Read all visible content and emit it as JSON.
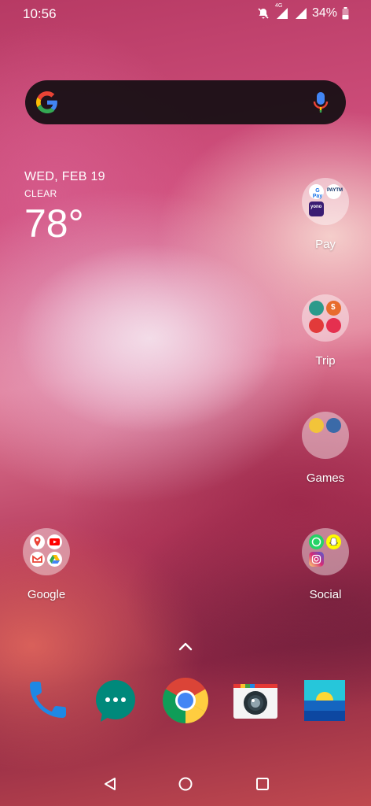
{
  "status_bar": {
    "time": "10:56",
    "network": "4G",
    "battery": "34%",
    "icons": [
      "mute-icon",
      "signal-icon",
      "signal-icon-2",
      "battery-icon"
    ]
  },
  "search_bar": {
    "logo": "google-g-icon",
    "mic": "mic-icon"
  },
  "weather": {
    "date": "WED, FEB 19",
    "condition": "CLEAR",
    "temperature": "78°"
  },
  "folders": [
    {
      "label": "Pay",
      "apps": [
        "google-pay",
        "paytm",
        "yono-sbi"
      ]
    },
    {
      "label": "Trip",
      "apps": [
        "trip-app-1",
        "trip-app-2",
        "trip-app-3",
        "trip-app-4"
      ]
    },
    {
      "label": "Games",
      "apps": [
        "game-1",
        "game-2"
      ]
    },
    {
      "label": "Google",
      "apps": [
        "maps",
        "youtube",
        "gmail",
        "drive"
      ]
    },
    {
      "label": "Social",
      "apps": [
        "whatsapp",
        "snapchat",
        "instagram"
      ]
    }
  ],
  "dock": [
    "phone",
    "messages",
    "chrome",
    "camera",
    "gallery"
  ],
  "nav": [
    "back-button",
    "home-button",
    "recents-button"
  ],
  "colors": {
    "search_bg": "#140e12",
    "google_blue": "#4285F4",
    "google_red": "#EA4335",
    "google_yellow": "#FBBC05",
    "google_green": "#34A853"
  }
}
